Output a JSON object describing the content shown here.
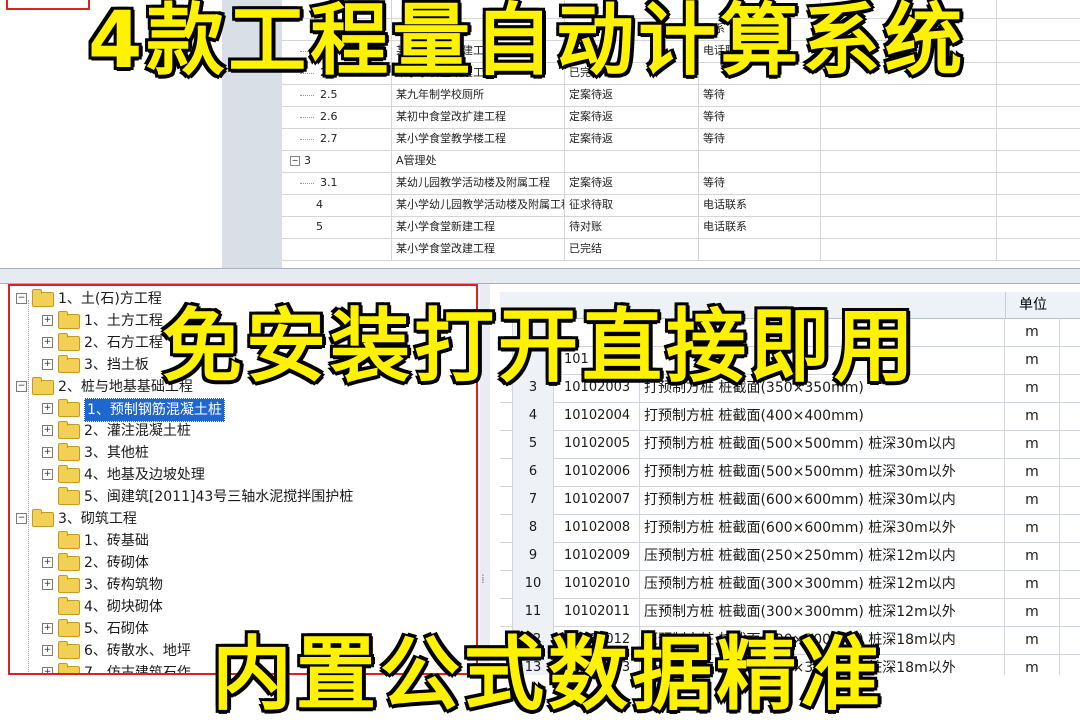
{
  "banners": {
    "top": "4款工程量自动计算系统",
    "middle": "免安装打开直接即用",
    "bottom": "内置公式数据精准"
  },
  "project_grid": {
    "rows": [
      {
        "id": "",
        "name": "",
        "status": "",
        "note": "",
        "kind": "partial"
      },
      {
        "id": "",
        "name": "",
        "status": "",
        "note": "联系",
        "kind": "partial"
      },
      {
        "id": "2.3",
        "name": "某小学食堂新建工程",
        "status": "待对账",
        "note": "电话联系",
        "kind": "child"
      },
      {
        "id": "2.4",
        "name": "某小学食堂改建工程",
        "status": "已完结",
        "note": "",
        "kind": "child"
      },
      {
        "id": "2.5",
        "name": "某九年制学校厕所",
        "status": "定案待返",
        "note": "等待",
        "kind": "child"
      },
      {
        "id": "2.6",
        "name": "某初中食堂改扩建工程",
        "status": "定案待返",
        "note": "等待",
        "kind": "child"
      },
      {
        "id": "2.7",
        "name": "某小学食堂教学楼工程",
        "status": "定案待返",
        "note": "等待",
        "kind": "child"
      },
      {
        "id": "3",
        "name": "A管理处",
        "status": "",
        "note": "",
        "kind": "group"
      },
      {
        "id": "3.1",
        "name": "某幼儿园教学活动楼及附属工程",
        "status": "定案待返",
        "note": "等待",
        "kind": "child"
      },
      {
        "id": "4",
        "name": "某小学幼儿园教学活动楼及附属工程",
        "status": "征求待取",
        "note": "电话联系",
        "kind": "top"
      },
      {
        "id": "5",
        "name": "某小学食堂新建工程",
        "status": "待对账",
        "note": "电话联系",
        "kind": "top"
      },
      {
        "id": "",
        "name": "某小学食堂改建工程",
        "status": "已完结",
        "note": "",
        "kind": "partial"
      }
    ]
  },
  "tree": {
    "items": [
      {
        "label": "1、土(石)方工程",
        "level": 0,
        "expander": "−"
      },
      {
        "label": "1、土方工程",
        "level": 1,
        "expander": "+"
      },
      {
        "label": "2、石方工程",
        "level": 1,
        "expander": "+"
      },
      {
        "label": "3、挡土板",
        "level": 1,
        "expander": "+"
      },
      {
        "label": "2、桩与地基基础工程",
        "level": 0,
        "expander": "−"
      },
      {
        "label": "1、预制钢筋混凝土桩",
        "level": 1,
        "expander": "+",
        "selected": true
      },
      {
        "label": "2、灌注混凝土桩",
        "level": 1,
        "expander": "+"
      },
      {
        "label": "3、其他桩",
        "level": 1,
        "expander": "+"
      },
      {
        "label": "4、地基及边坡处理",
        "level": 1,
        "expander": "+"
      },
      {
        "label": "5、闽建筑[2011]43号三轴水泥搅拌围护桩",
        "level": 1,
        "expander": ""
      },
      {
        "label": "3、砌筑工程",
        "level": 0,
        "expander": "−"
      },
      {
        "label": "1、砖基础",
        "level": 1,
        "expander": ""
      },
      {
        "label": "2、砖砌体",
        "level": 1,
        "expander": "+"
      },
      {
        "label": "3、砖构筑物",
        "level": 1,
        "expander": "+"
      },
      {
        "label": "4、砌块砌体",
        "level": 1,
        "expander": ""
      },
      {
        "label": "5、石砌体",
        "level": 1,
        "expander": "+"
      },
      {
        "label": "6、砖散水、地坪",
        "level": 1,
        "expander": "+"
      },
      {
        "label": "7、仿古建筑石作",
        "level": 1,
        "expander": "+"
      }
    ]
  },
  "quota_table": {
    "unit_header": "单位",
    "rows": [
      {
        "no": "",
        "code": "",
        "name": "",
        "unit": "m"
      },
      {
        "no": "",
        "code": "101",
        "name": "",
        "unit": "m"
      },
      {
        "no": "3",
        "code": "10102003",
        "name": "打预制方桩 桩截面(350×350mm)",
        "unit": "m"
      },
      {
        "no": "4",
        "code": "10102004",
        "name": "打预制方桩 桩截面(400×400mm)",
        "unit": "m"
      },
      {
        "no": "5",
        "code": "10102005",
        "name": "打预制方桩 桩截面(500×500mm) 桩深30m以内",
        "unit": "m"
      },
      {
        "no": "6",
        "code": "10102006",
        "name": "打预制方桩 桩截面(500×500mm) 桩深30m以外",
        "unit": "m"
      },
      {
        "no": "7",
        "code": "10102007",
        "name": "打预制方桩 桩截面(600×600mm) 桩深30m以内",
        "unit": "m"
      },
      {
        "no": "8",
        "code": "10102008",
        "name": "打预制方桩 桩截面(600×600mm) 桩深30m以外",
        "unit": "m"
      },
      {
        "no": "9",
        "code": "10102009",
        "name": "压预制方桩 桩截面(250×250mm) 桩深12m以内",
        "unit": "m"
      },
      {
        "no": "10",
        "code": "10102010",
        "name": "压预制方桩 桩截面(300×300mm) 桩深12m以内",
        "unit": "m"
      },
      {
        "no": "11",
        "code": "10102011",
        "name": "压预制方桩 桩截面(300×300mm) 桩深12m以外",
        "unit": "m"
      },
      {
        "no": "12",
        "code": "10102012",
        "name": "压预制方桩 桩截面(300×300mm) 桩深18m以内",
        "unit": "m"
      },
      {
        "no": "13",
        "code": "10102013",
        "name": "压预制方桩 桩截面(300×300mm) 桩深18m以外",
        "unit": "m"
      }
    ]
  },
  "colors": {
    "banner_fill": "#fff200",
    "banner_stroke": "#000000",
    "selection": "#1e66d0",
    "highlight_border": "#e02020"
  }
}
